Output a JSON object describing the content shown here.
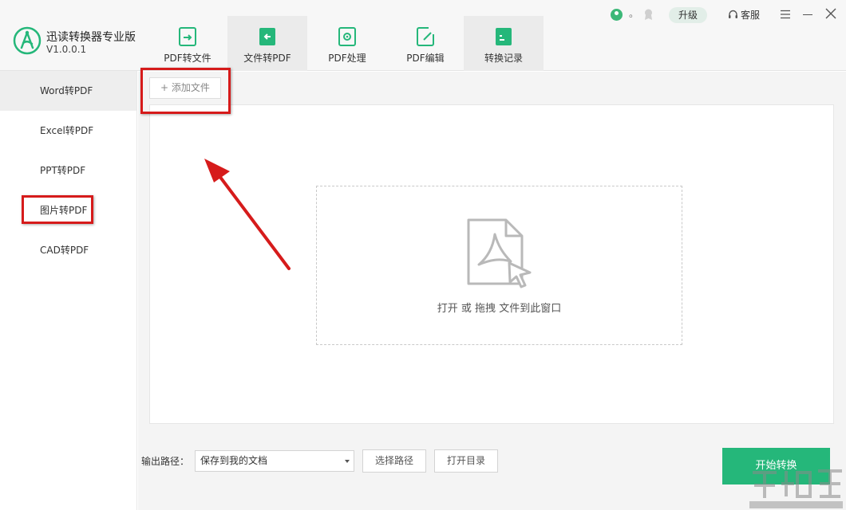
{
  "app": {
    "title": "迅读转换器专业版",
    "version": "V1.0.0.1"
  },
  "tabs": [
    {
      "label": "PDF转文件",
      "icon": "pdf-export-icon"
    },
    {
      "label": "文件转PDF",
      "icon": "file-to-pdf-icon"
    },
    {
      "label": "PDF处理",
      "icon": "pdf-process-icon"
    },
    {
      "label": "PDF编辑",
      "icon": "pdf-edit-icon"
    },
    {
      "label": "转换记录",
      "icon": "history-icon"
    }
  ],
  "top_right": {
    "user_name": "。",
    "upgrade_label": "升级",
    "service_label": "客服"
  },
  "sidebar": {
    "items": [
      {
        "label": "Word转PDF"
      },
      {
        "label": "Excel转PDF"
      },
      {
        "label": "PPT转PDF"
      },
      {
        "label": "图片转PDF"
      },
      {
        "label": "CAD转PDF"
      }
    ]
  },
  "main": {
    "add_file_label": "添加文件",
    "drop_hint": "打开 或 拖拽 文件到此窗口"
  },
  "footer": {
    "output_path_label": "输出路径：",
    "output_path_value": "保存到我的文档",
    "choose_path_label": "选择路径",
    "open_dir_label": "打开目录",
    "start_label": "开始转换"
  },
  "colors": {
    "brand_green": "#25b77a",
    "annotation_red": "#d61b1b"
  }
}
